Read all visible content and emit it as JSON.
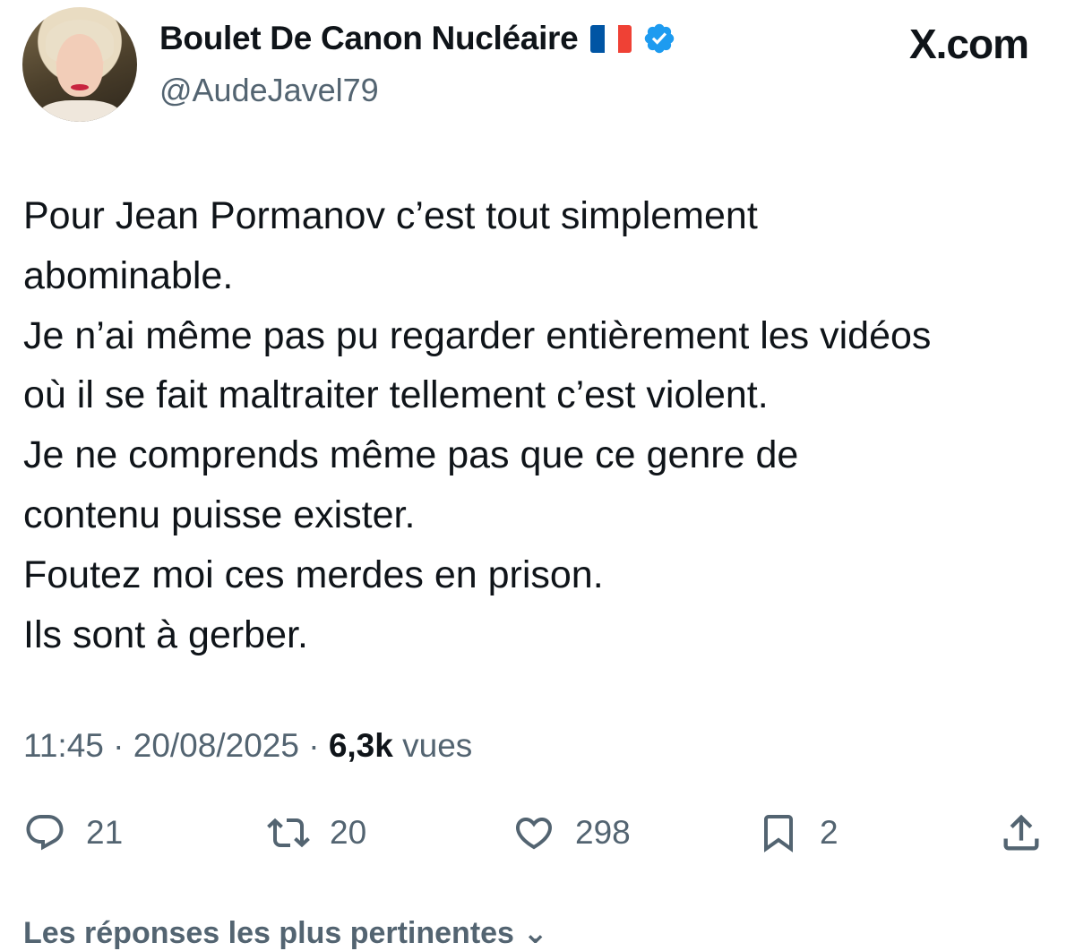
{
  "author": {
    "display_name": "Boulet De Canon Nucléaire",
    "handle": "@AudeJavel79",
    "flag_colors": [
      "#0055a4",
      "#ffffff",
      "#ef4135"
    ],
    "verified_color": "#1d9bf0"
  },
  "brand": "X.com",
  "tweet": {
    "lines": [
      "Pour Jean Pormanov c’est tout simplement",
      "abominable.",
      "Je n’ai même pas pu regarder entièrement les vidéos",
      "où il se fait maltraiter tellement c’est violent.",
      "Je ne comprends même pas que ce genre de",
      "contenu puisse exister.",
      "Foutez moi ces merdes en prison.",
      "Ils sont à gerber."
    ]
  },
  "meta": {
    "time": "11:45",
    "separator": "·",
    "date": "20/08/2025",
    "views_count": "6,3k",
    "views_label": "vues"
  },
  "actions": {
    "replies": "21",
    "reposts": "20",
    "likes": "298",
    "bookmarks": "2"
  },
  "icons": {
    "reply": "reply-icon",
    "repost": "repost-icon",
    "like": "heart-icon",
    "bookmark": "bookmark-icon",
    "share": "share-icon"
  },
  "replies_header": "Les réponses les plus pertinentes"
}
